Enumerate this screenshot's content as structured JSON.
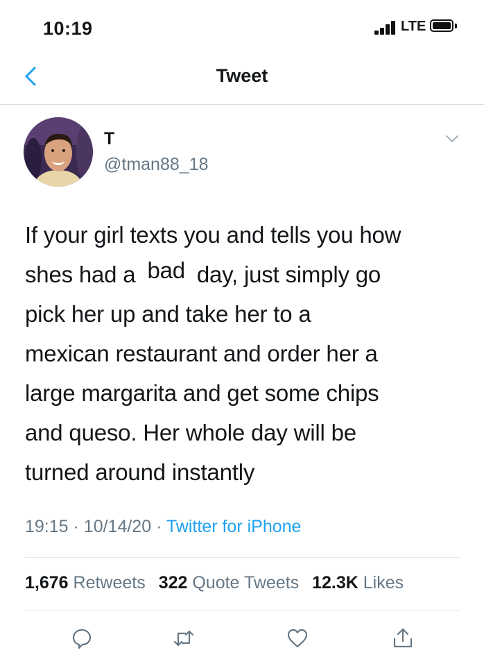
{
  "status_bar": {
    "time": "10:19",
    "network": "LTE"
  },
  "nav": {
    "title": "Tweet"
  },
  "tweet": {
    "author": {
      "display_name": "T",
      "handle": "@tman88_18"
    },
    "text": {
      "line1": "If your girl texts you and tells you how",
      "line2_before": "shes had a",
      "line2_highlight": "bad",
      "line2_after": "day, just simply go",
      "line3": "pick her up and take her to a",
      "line4": "mexican restaurant and order her a",
      "line5": "large margarita and get some chips",
      "line6": "and queso. Her whole day will be",
      "line7": "turned around instantly"
    },
    "time": "19:15",
    "date": "10/14/20",
    "separator": "·",
    "source": "Twitter for iPhone"
  },
  "stats": {
    "retweets_count": "1,676",
    "retweets_label": "Retweets",
    "quotes_count": "322",
    "quotes_label": "Quote Tweets",
    "likes_count": "12.3K",
    "likes_label": "Likes"
  },
  "actions": [
    "reply-icon",
    "retweet-icon",
    "like-icon",
    "share-icon"
  ],
  "colors": {
    "text_primary": "#14171a",
    "text_secondary": "#657786",
    "accent": "#1da1f2",
    "divider": "#e1e8ed"
  }
}
